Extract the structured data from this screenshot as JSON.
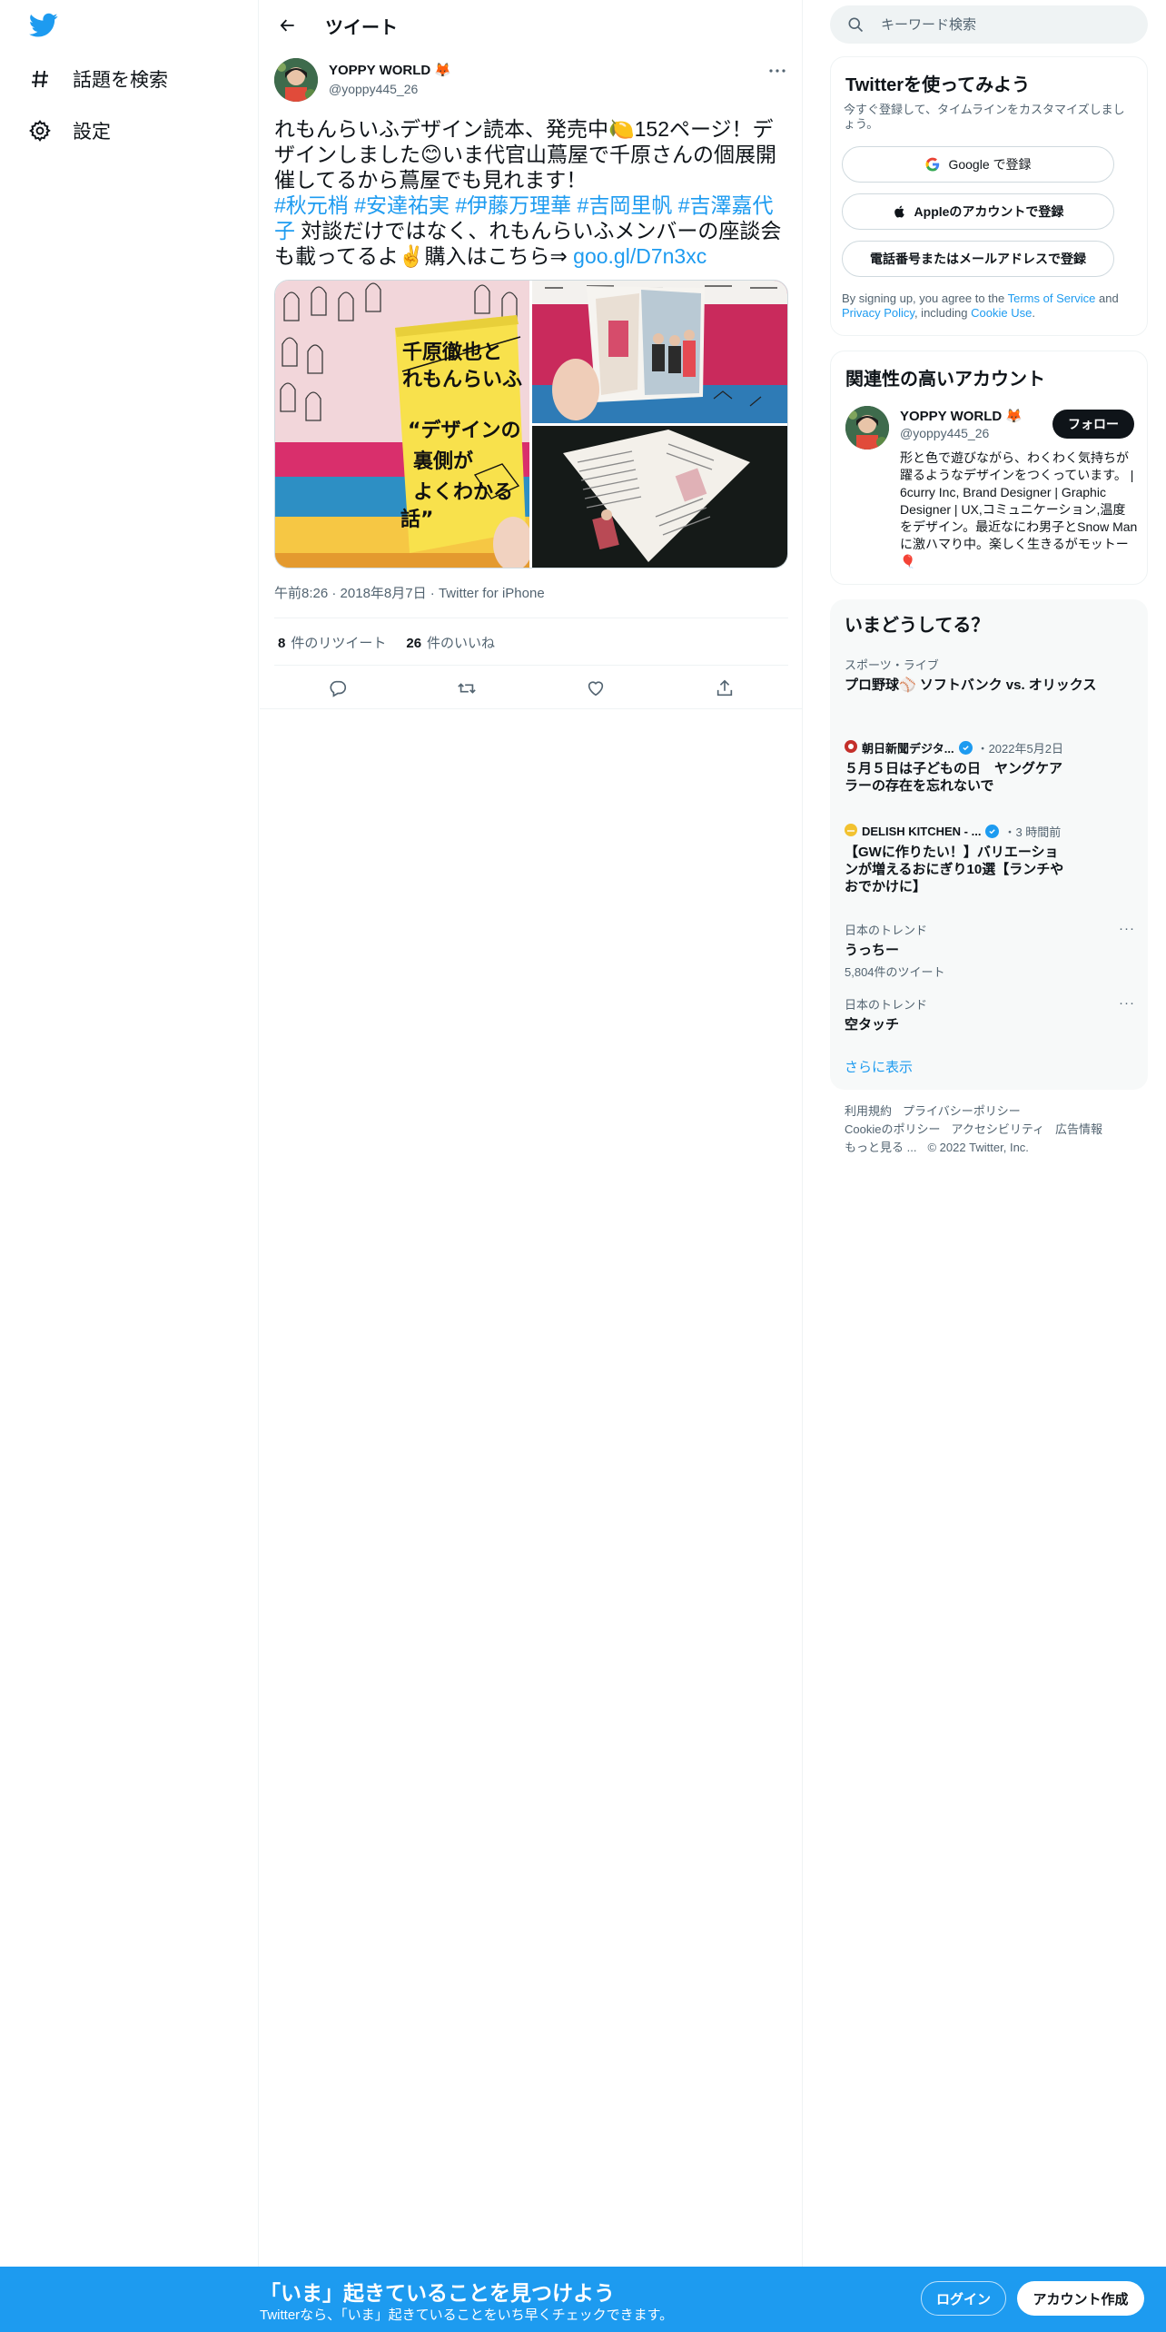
{
  "nav": {
    "items": [
      {
        "label": "話題を検索",
        "icon": "hashtag-icon"
      },
      {
        "label": "設定",
        "icon": "gear-icon"
      }
    ]
  },
  "header": {
    "title": "ツイート"
  },
  "tweet": {
    "author_name": "YOPPY WORLD 🦊",
    "author_handle": "@yoppy445_26",
    "text_1": "れもんらいふデザイン読本、発売中🍋152ページ！デザインしました😊いま代官山蔦屋で千原さんの個展開催してるから蔦屋でも見れます！",
    "hashtags": "#秋元梢 #安達祐実 #伊藤万理華 #吉岡里帆 #吉澤嘉代子",
    "text_2": " 対談だけではなく、れもんらいふメンバーの座談会も載ってるよ✌️購入はこちら⇒ ",
    "link": "goo.gl/D7n3xc",
    "book_cover_lines": [
      "千原徹也と",
      "れもんらいふ",
      "“デザインの",
      "裏側が",
      "よくわかる",
      "話”"
    ],
    "time": "午前8:26",
    "date": "2018年8月7日",
    "source": "Twitter for iPhone",
    "retweet_count": "8",
    "retweet_label": "件のリツイート",
    "like_count": "26",
    "like_label": "件のいいね"
  },
  "search": {
    "placeholder": "キーワード検索"
  },
  "signup": {
    "title": "Twitterを使ってみよう",
    "subtitle": "今すぐ登録して、タイムラインをカスタマイズしましょう。",
    "google_btn": "Google で登録",
    "apple_btn": "Appleのアカウントで登録",
    "phone_btn": "電話番号またはメールアドレスで登録",
    "terms_1": "By signing up, you agree to the ",
    "terms_link_1": "Terms of Service",
    "terms_2": " and ",
    "terms_link_2": "Privacy Policy",
    "terms_3": ", including ",
    "terms_link_3": "Cookie Use",
    "terms_4": "."
  },
  "related": {
    "title": "関連性の高いアカウント",
    "name": "YOPPY WORLD 🦊",
    "handle": "@yoppy445_26",
    "follow_label": "フォロー",
    "bio": "形と色で遊びながら、わくわく気持ちが躍るようなデザインをつくっています。 | 6curry Inc, Brand Designer | Graphic Designer | UX,コミュニケーション,温度をデザイン。最近なにわ男子とSnow Manに激ハマり中。楽しく生きるがモットー🎈"
  },
  "trends": {
    "title": "いまどうしてる？",
    "items": [
      {
        "category": "スポーツ・ライブ",
        "title": "プロ野球⚾ ソフトバンク vs. オリックス"
      },
      {
        "source": "朝日新聞デジタ...",
        "meta": "・2022年5月2日",
        "title": "５月５日は子どもの日　ヤングケアラーの存在を忘れないで"
      },
      {
        "source": "DELISH KITCHEN - ...",
        "meta": "・3 時間前",
        "title": "【GWに作りたい！】バリエーションが増えるおにぎり10選【ランチやおでかけに】"
      },
      {
        "category": "日本のトレンド",
        "title": "うっちー",
        "count": "5,804件のツイート"
      },
      {
        "category": "日本のトレンド",
        "title": "空タッチ"
      }
    ],
    "more_label": "さらに表示"
  },
  "footer": {
    "links": [
      "利用規約",
      "プライバシーポリシー",
      "Cookieのポリシー",
      "アクセシビリティ",
      "広告情報",
      "もっと見る ...",
      "© 2022 Twitter, Inc."
    ]
  },
  "bottom_bar": {
    "title": "「いま」起きていることを見つけよう",
    "subtitle": "Twitterなら、「いま」起きていることをいち早くチェックできます。",
    "login_label": "ログイン",
    "signup_label": "アカウント作成"
  },
  "colors": {
    "accent": "#1d9bf0",
    "text": "#0f1419",
    "muted": "#536471",
    "border": "#eff3f4"
  }
}
